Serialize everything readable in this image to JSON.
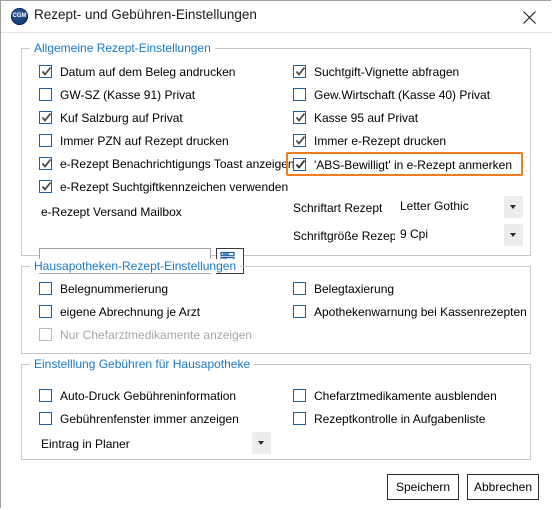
{
  "window": {
    "title": "Rezept- und Gebühren-Einstellungen",
    "app_icon": "cgm-logo-icon",
    "app_icon_text": "CGM",
    "close_icon": "close-icon"
  },
  "groups": {
    "general": {
      "legend": "Allgemeine  Rezept-Einstellungen",
      "left_checkboxes": [
        {
          "label": "Datum auf dem Beleg andrucken",
          "checked": true,
          "disabled": false
        },
        {
          "label": "GW-SZ (Kasse 91)  Privat",
          "checked": false,
          "disabled": false
        },
        {
          "label": "Kuf Salzburg auf Privat",
          "checked": true,
          "disabled": false
        },
        {
          "label": "Immer PZN auf Rezept drucken",
          "checked": false,
          "disabled": false
        },
        {
          "label": "e-Rezept Benachrichtigungs Toast anzeigen",
          "checked": true,
          "disabled": false
        },
        {
          "label": "e-Rezept Suchtgiftkennzeichen verwenden",
          "checked": true,
          "disabled": false
        }
      ],
      "right_checkboxes": [
        {
          "label": "Suchtgift-Vignette abfragen",
          "checked": true,
          "disabled": false
        },
        {
          "label": "Gew.Wirtschaft (Kasse 40)  Privat",
          "checked": false,
          "disabled": false
        },
        {
          "label": "Kasse 95 auf Privat",
          "checked": true,
          "disabled": false
        },
        {
          "label": "Immer e-Rezept drucken",
          "checked": true,
          "disabled": false
        },
        {
          "label": "'ABS-Bewilligt' in e-Rezept anmerken",
          "checked": true,
          "disabled": false,
          "highlighted": true
        }
      ],
      "mailbox": {
        "label": "e-Rezept Versand Mailbox",
        "value": "",
        "placeholder": "",
        "browse_icon": "list-search-icon"
      },
      "font_family": {
        "label": "Schriftart Rezept",
        "value": "Letter Gothic",
        "arrow_icon": "chevron-down-icon"
      },
      "font_size": {
        "label": "Schriftgröße Rezept",
        "value": "9 Cpi",
        "arrow_icon": "chevron-down-icon"
      }
    },
    "hausapotheke": {
      "legend": "Hausapotheken-Rezept-Einstellungen",
      "left_checkboxes": [
        {
          "label": "Belegnummerierung",
          "checked": false,
          "disabled": false
        },
        {
          "label": "eigene Abrechnung je Arzt",
          "checked": false,
          "disabled": false
        },
        {
          "label": "Nur Chefarztmedikamente anzeigen",
          "checked": false,
          "disabled": true
        }
      ],
      "right_checkboxes": [
        {
          "label": "Belegtaxierung",
          "checked": false,
          "disabled": false
        },
        {
          "label": "Apothekenwarnung bei Kassenrezepten",
          "checked": false,
          "disabled": false
        }
      ]
    },
    "gebuehren": {
      "legend": "Einstelllung Gebühren für Hausapotheke",
      "left_checkboxes": [
        {
          "label": "Auto-Druck Gebühreninformation",
          "checked": false,
          "disabled": false
        },
        {
          "label": "Gebührenfenster immer anzeigen",
          "checked": false,
          "disabled": false
        }
      ],
      "right_checkboxes": [
        {
          "label": "Chefarztmedikamente ausblenden",
          "checked": false,
          "disabled": false
        },
        {
          "label": "Rezeptkontrolle in Aufgabenliste",
          "checked": false,
          "disabled": false
        }
      ],
      "planner": {
        "label": "Eintrag in Planer",
        "value": "",
        "arrow_icon": "chevron-down-icon"
      }
    }
  },
  "footer": {
    "save_label": "Speichern",
    "cancel_label": "Abbrechen"
  },
  "colors": {
    "legend": "#1878c8",
    "highlight": "#f07d1b",
    "checkbox_border": "#1e5fa8",
    "group_border": "#c8c8c8"
  }
}
